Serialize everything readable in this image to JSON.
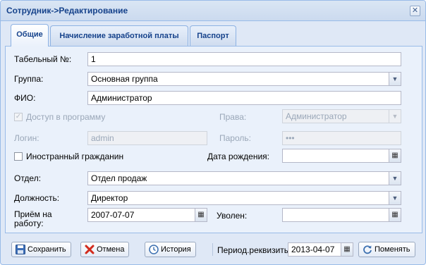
{
  "window": {
    "title": "Сотрудник->Редактирование"
  },
  "tabs": [
    {
      "label": "Общие"
    },
    {
      "label": "Начисление заработной платы"
    },
    {
      "label": "Паспорт"
    }
  ],
  "form": {
    "tab_number": {
      "label": "Табельный №:",
      "value": "1"
    },
    "group": {
      "label": "Группа:",
      "value": "Основная группа"
    },
    "fio": {
      "label": "ФИО:",
      "value": "Администратор"
    },
    "access": {
      "label": "Доступ в программу",
      "checked": true,
      "disabled": true
    },
    "rights": {
      "label": "Права:",
      "value": "Администратор"
    },
    "login": {
      "label": "Логин:",
      "value": "admin"
    },
    "password": {
      "label": "Пароль:",
      "value": "•••"
    },
    "foreign": {
      "label": "Иностранный гражданин",
      "checked": false
    },
    "birth_date": {
      "label": "Дата рождения:",
      "value": ""
    },
    "department": {
      "label": "Отдел:",
      "value": "Отдел продаж"
    },
    "position": {
      "label": "Должность:",
      "value": "Директор"
    },
    "hire_date": {
      "label_line1": "Приём на",
      "label_line2": "работу:",
      "value": "2007-07-07"
    },
    "fired": {
      "label": "Уволен:",
      "value": ""
    }
  },
  "toolbar": {
    "save_label": "Сохранить",
    "cancel_label": "Отмена",
    "history_label": "История",
    "period_label": "Период.реквизиты:",
    "period_value": "2013-04-07",
    "change_label": "Поменять"
  },
  "icons": {
    "close": "close-icon",
    "dropdown": "chevron-down-icon",
    "calendar": "calendar-icon",
    "save": "floppy-disk-icon",
    "cancel": "red-x-icon",
    "history": "clock-icon",
    "change": "refresh-icon"
  },
  "colors": {
    "header_text": "#15428b",
    "window_bg": "#dfe8f6",
    "panel_bg": "#eaf1fb",
    "border": "#99bbe8",
    "disabled_text": "#9aa7b8"
  }
}
